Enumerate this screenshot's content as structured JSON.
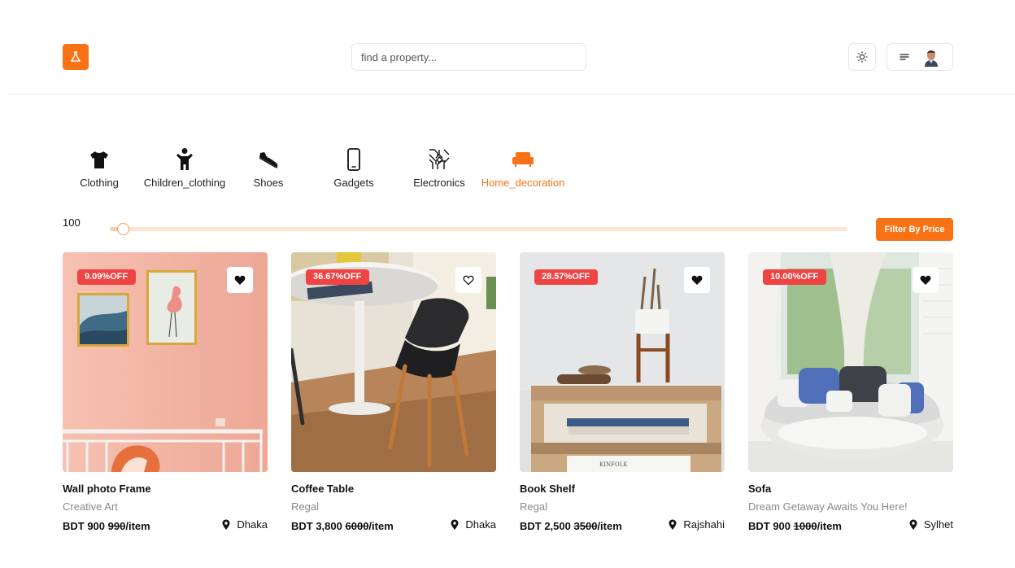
{
  "header": {
    "search_placeholder": "find a property..."
  },
  "colors": {
    "accent": "#f97316",
    "badge": "#ef4444"
  },
  "categories": [
    {
      "label": "Clothing",
      "icon": "tshirt-icon",
      "active": false
    },
    {
      "label": "Children_clothing",
      "icon": "child-icon",
      "active": false
    },
    {
      "label": "Shoes",
      "icon": "shoe-icon",
      "active": false
    },
    {
      "label": "Gadgets",
      "icon": "phone-icon",
      "active": false
    },
    {
      "label": "Electronics",
      "icon": "circuit-icon",
      "active": false
    },
    {
      "label": "Home_decoration",
      "icon": "sofa-icon",
      "active": true
    }
  ],
  "price_filter": {
    "value": "100",
    "slider_fraction": 0.01,
    "button_label": "Filter By Price"
  },
  "products": [
    {
      "discount": "9.09%OFF",
      "title": "Wall photo Frame",
      "subtitle": "Creative Art",
      "price": "BDT 900",
      "old_price": "990",
      "unit": "/item",
      "location": "Dhaka",
      "favorited": true
    },
    {
      "discount": "36.67%OFF",
      "title": "Coffee Table",
      "subtitle": "Regal",
      "price": "BDT 3,800",
      "old_price": "6000",
      "unit": "/item",
      "location": "Dhaka",
      "favorited": false
    },
    {
      "discount": "28.57%OFF",
      "title": "Book Shelf",
      "subtitle": "Regal",
      "price": "BDT 2,500",
      "old_price": "3500",
      "unit": "/item",
      "location": "Rajshahi",
      "favorited": true
    },
    {
      "discount": "10.00%OFF",
      "title": "Sofa",
      "subtitle": "Dream Getaway Awaits You Here!",
      "price": "BDT 900",
      "old_price": "1000",
      "unit": "/item",
      "location": "Sylhet",
      "favorited": true
    }
  ]
}
